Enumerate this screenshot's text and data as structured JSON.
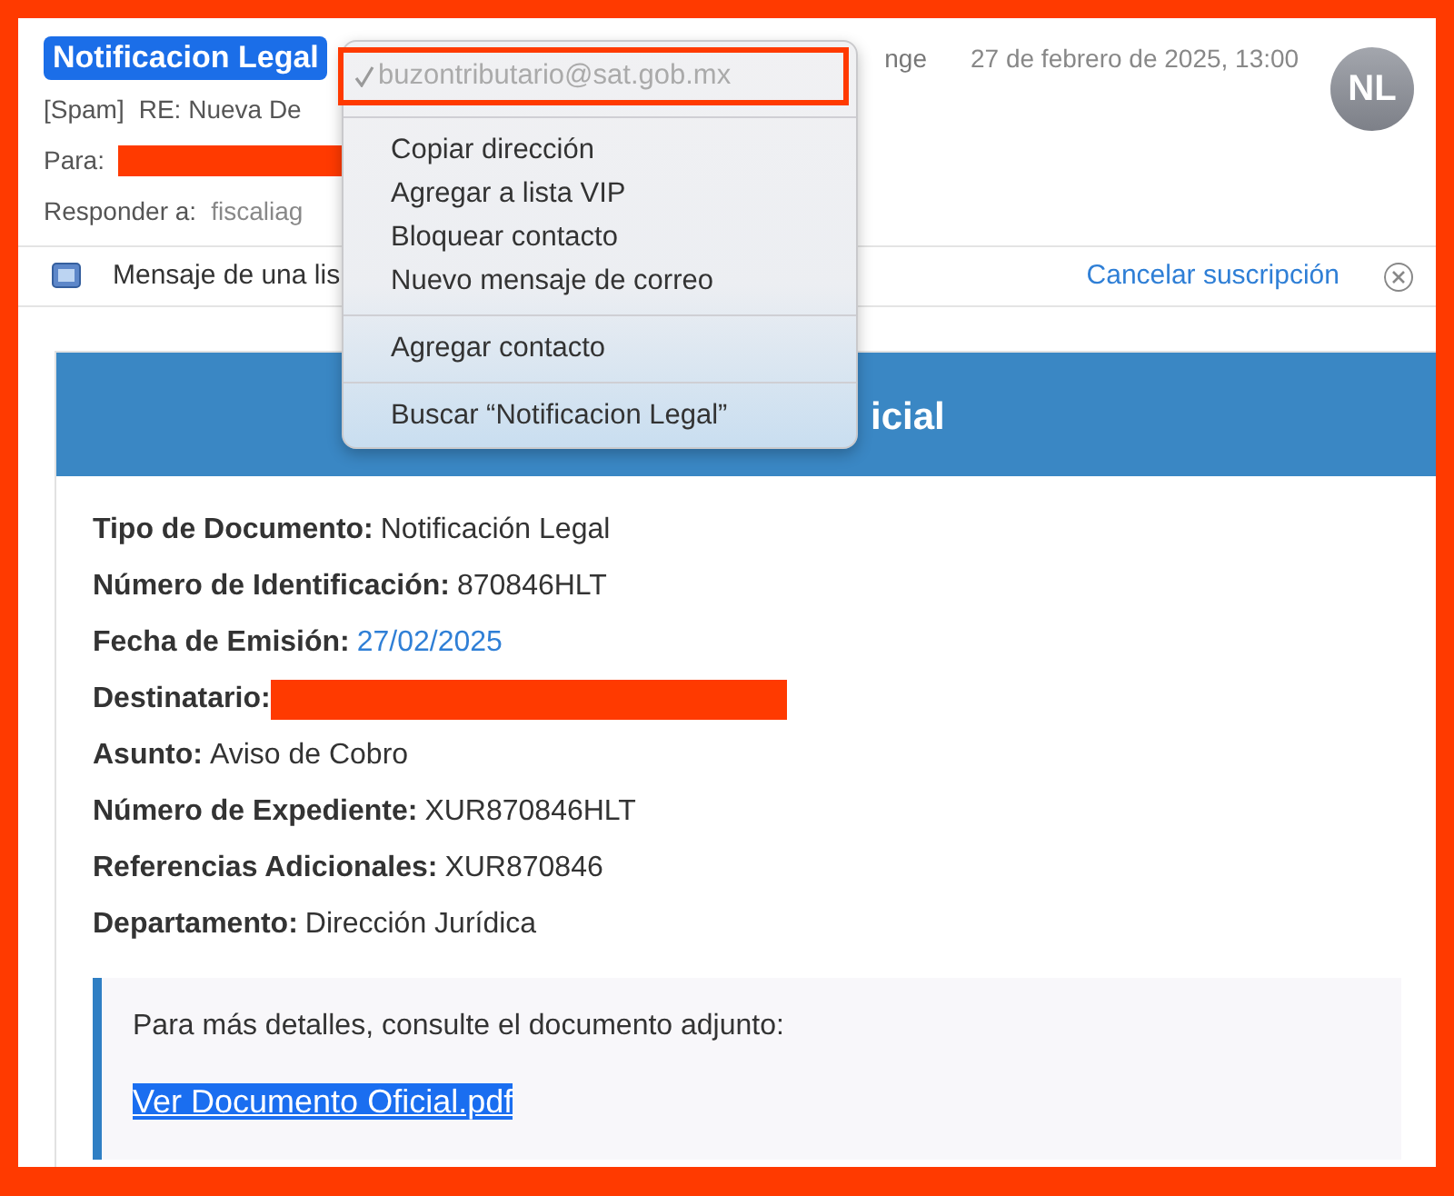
{
  "sender": {
    "name": "Notificacion Legal",
    "selected": true
  },
  "header_fragment": "nge",
  "date": "27 de febrero de 2025, 13:00",
  "avatar": "NL",
  "subject": {
    "tag": "[Spam]",
    "text": "RE: Nueva De"
  },
  "to": {
    "label": "Para:",
    "redacted": true
  },
  "reply_to": {
    "label": "Responder a:",
    "value": "fiscaliag"
  },
  "list_banner": {
    "text": "Mensaje de una lis",
    "link": "Cancelar suscripción"
  },
  "context_menu": {
    "items": [
      {
        "kind": "address",
        "label": "buzontributario@sat.gob.mx",
        "checked": true,
        "disabled": true,
        "highlighted": true
      },
      {
        "kind": "separator"
      },
      {
        "kind": "item",
        "label": "Copiar dirección"
      },
      {
        "kind": "item",
        "label": "Agregar a lista VIP"
      },
      {
        "kind": "item",
        "label": "Bloquear contacto"
      },
      {
        "kind": "item",
        "label": "Nuevo mensaje de correo"
      },
      {
        "kind": "separator"
      },
      {
        "kind": "item",
        "label": "Agregar contacto"
      },
      {
        "kind": "separator"
      },
      {
        "kind": "item",
        "label": "Buscar “Notificacion Legal”"
      }
    ]
  },
  "email": {
    "heading": "icial",
    "fields": [
      {
        "label": "Tipo de Documento:",
        "kind": "text",
        "value": "Notificación Legal"
      },
      {
        "label": "Número de Identificación:",
        "kind": "text",
        "value": "870846HLT"
      },
      {
        "label": "Fecha de Emisión:",
        "kind": "link",
        "value": "27/02/2025"
      },
      {
        "label": "Destinatario:",
        "kind": "redacted"
      },
      {
        "label": "Asunto:",
        "kind": "text",
        "value": "Aviso de Cobro"
      },
      {
        "label": "Número de Expediente:",
        "kind": "text",
        "value": "XUR870846HLT"
      },
      {
        "label": "Referencias Adicionales:",
        "kind": "text",
        "value": "XUR870846"
      },
      {
        "label": "Departamento:",
        "kind": "text",
        "value": "Dirección Jurídica"
      }
    ],
    "callout": {
      "text": "Para más detalles, consulte el documento adjunto:",
      "link": "Ver Documento Oficial.pdf",
      "link_selected": true
    }
  }
}
